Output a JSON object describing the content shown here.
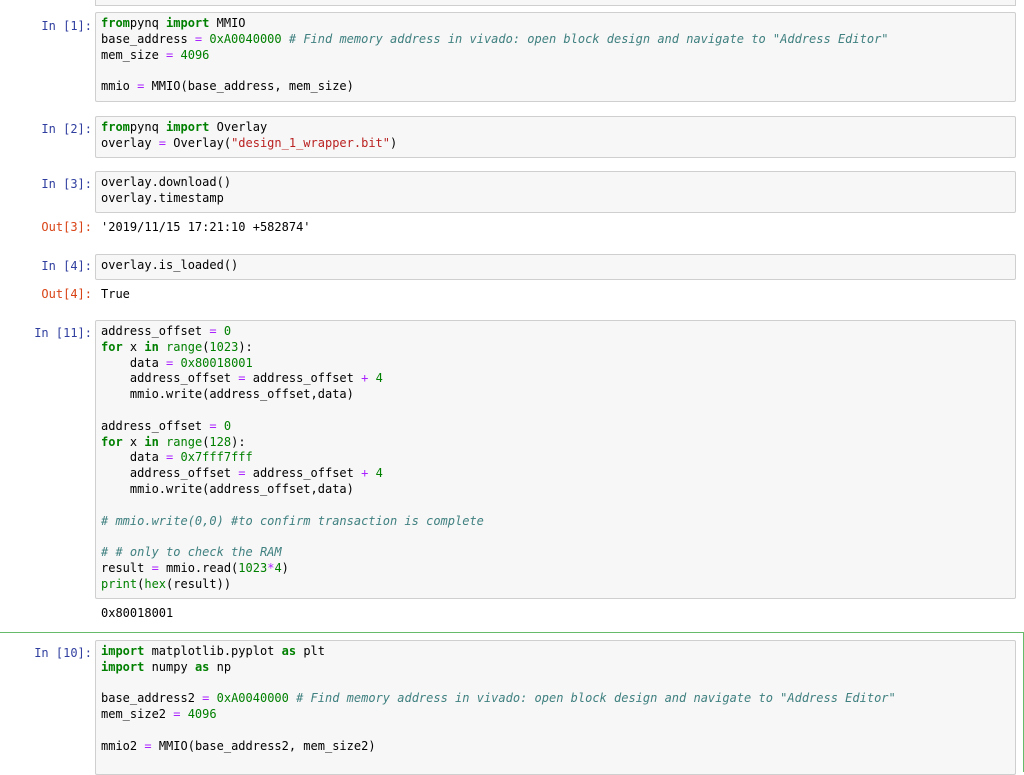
{
  "cells": [
    {
      "prompt": "In [1]:",
      "lines": [
        [
          [
            "kw",
            "from"
          ],
          [
            "",
            "pynq "
          ],
          [
            "kw",
            "import"
          ],
          [
            "",
            " MMIO"
          ]
        ],
        [
          [
            "",
            "base_address "
          ],
          [
            "op",
            "="
          ],
          [
            "num",
            " 0xA0040000"
          ],
          [
            "",
            " "
          ],
          [
            "cm",
            "# Find memory address in vivado: open block design and navigate to \"Address Editor\""
          ]
        ],
        [
          [
            "",
            "mem_size "
          ],
          [
            "op",
            "="
          ],
          [
            "num",
            " 4096"
          ]
        ],
        [],
        [
          [
            "",
            "mmio "
          ],
          [
            "op",
            "="
          ],
          [
            "",
            " MMIO(base_address, mem_size)"
          ]
        ]
      ]
    },
    {
      "prompt": "In [2]:",
      "lines": [
        [
          [
            "kw",
            "from"
          ],
          [
            "",
            "pynq "
          ],
          [
            "kw",
            "import"
          ],
          [
            "",
            " Overlay"
          ]
        ],
        [
          [
            "",
            "overlay "
          ],
          [
            "op",
            "="
          ],
          [
            "",
            " Overlay("
          ],
          [
            "str",
            "\"design_1_wrapper.bit\""
          ],
          [
            "",
            ")"
          ]
        ]
      ]
    },
    {
      "prompt": "In [3]:",
      "lines": [
        [
          [
            "",
            "overlay.download()"
          ]
        ],
        [
          [
            "",
            "overlay.timestamp"
          ]
        ]
      ],
      "out_prompt": "Out[3]:",
      "output": "'2019/11/15 17:21:10 +582874'"
    },
    {
      "prompt": "In [4]:",
      "lines": [
        [
          [
            "",
            "overlay.is_loaded()"
          ]
        ]
      ],
      "out_prompt": "Out[4]:",
      "output": "True"
    },
    {
      "prompt": "In [11]:",
      "lines": [
        [
          [
            "",
            "address_offset "
          ],
          [
            "op",
            "="
          ],
          [
            "num",
            " 0"
          ]
        ],
        [
          [
            "kw",
            "for"
          ],
          [
            "",
            " x "
          ],
          [
            "kw",
            "in"
          ],
          [
            "",
            " "
          ],
          [
            "bi",
            "range"
          ],
          [
            "",
            "("
          ],
          [
            "num",
            "1023"
          ],
          [
            "",
            "):"
          ]
        ],
        [
          [
            "",
            "    data "
          ],
          [
            "op",
            "="
          ],
          [
            "num",
            " 0x80018001"
          ]
        ],
        [
          [
            "",
            "    address_offset "
          ],
          [
            "op",
            "="
          ],
          [
            "",
            " address_offset "
          ],
          [
            "op",
            "+"
          ],
          [
            "num",
            " 4"
          ]
        ],
        [
          [
            "",
            "    mmio.write(address_offset,data)"
          ]
        ],
        [],
        [
          [
            "",
            "address_offset "
          ],
          [
            "op",
            "="
          ],
          [
            "num",
            " 0"
          ]
        ],
        [
          [
            "kw",
            "for"
          ],
          [
            "",
            " x "
          ],
          [
            "kw",
            "in"
          ],
          [
            "",
            " "
          ],
          [
            "bi",
            "range"
          ],
          [
            "",
            "("
          ],
          [
            "num",
            "128"
          ],
          [
            "",
            "):"
          ]
        ],
        [
          [
            "",
            "    data "
          ],
          [
            "op",
            "="
          ],
          [
            "num",
            " 0x7fff7fff"
          ]
        ],
        [
          [
            "",
            "    address_offset "
          ],
          [
            "op",
            "="
          ],
          [
            "",
            " address_offset "
          ],
          [
            "op",
            "+"
          ],
          [
            "num",
            " 4"
          ]
        ],
        [
          [
            "",
            "    mmio.write(address_offset,data)"
          ]
        ],
        [],
        [
          [
            "cm",
            "# mmio.write(0,0) #to confirm transaction is complete"
          ]
        ],
        [],
        [
          [
            "cm",
            "# # only to check the RAM"
          ]
        ],
        [
          [
            "",
            "result "
          ],
          [
            "op",
            "="
          ],
          [
            "",
            " mmio.read("
          ],
          [
            "num",
            "1023"
          ],
          [
            "op",
            "*"
          ],
          [
            "num",
            "4"
          ],
          [
            "",
            ")"
          ]
        ],
        [
          [
            "bi",
            "print"
          ],
          [
            "",
            "("
          ],
          [
            "bi",
            "hex"
          ],
          [
            "",
            "(result))"
          ]
        ]
      ],
      "stream_output": "0x80018001"
    },
    {
      "prompt": "In [10]:",
      "lines": [
        [
          [
            "kw",
            "import"
          ],
          [
            "",
            " matplotlib.pyplot "
          ],
          [
            "kw",
            "as"
          ],
          [
            "",
            " plt"
          ]
        ],
        [
          [
            "kw",
            "import"
          ],
          [
            "",
            " numpy "
          ],
          [
            "kw",
            "as"
          ],
          [
            "",
            " np"
          ]
        ],
        [],
        [
          [
            "",
            "base_address2 "
          ],
          [
            "op",
            "="
          ],
          [
            "num",
            " 0xA0040000"
          ],
          [
            "",
            " "
          ],
          [
            "cm",
            "# Find memory address in vivado: open block design and navigate to \"Address Editor\""
          ]
        ],
        [
          [
            "",
            "mem_size2 "
          ],
          [
            "op",
            "="
          ],
          [
            "num",
            " 4096"
          ]
        ],
        [],
        [
          [
            "",
            "mmio2 "
          ],
          [
            "op",
            "="
          ],
          [
            "",
            " MMIO(base_address2, mem_size2)"
          ]
        ]
      ]
    }
  ]
}
